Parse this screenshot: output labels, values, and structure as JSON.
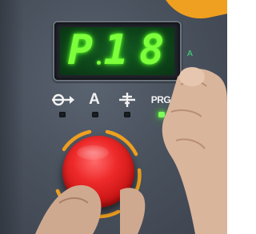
{
  "display": {
    "digits": [
      "P",
      "1",
      "8"
    ],
    "decimal_point": true,
    "unit_label": "A",
    "digit_color": "#7dff3c",
    "background_color": "#0f4a1a"
  },
  "mode_buttons": [
    {
      "icon": "torch-arrow-icon",
      "led_on": false
    },
    {
      "icon": "current-icon",
      "label": "A",
      "led_on": false
    },
    {
      "icon": "ground-clamp-icon",
      "led_on": false
    },
    {
      "icon": "program-icon",
      "label": "PRG",
      "led_on": true
    }
  ],
  "knob": {
    "color": "#e02020",
    "ring_color": "#f0a020"
  },
  "colors": {
    "panel": "#4a525e",
    "accent": "#f0a020",
    "led_on": "#7dff5c"
  }
}
